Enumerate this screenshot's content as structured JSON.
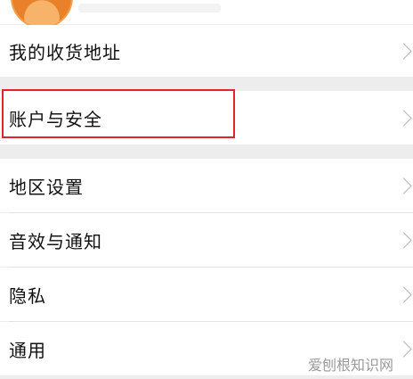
{
  "settings": {
    "items": [
      {
        "label": "我的收货地址"
      },
      {
        "label": "账户与安全"
      },
      {
        "label": "地区设置"
      },
      {
        "label": "音效与通知"
      },
      {
        "label": "隐私"
      },
      {
        "label": "通用"
      }
    ],
    "highlighted_item": "账户与安全",
    "highlight_color": "#e0242b"
  },
  "watermark": {
    "text": "爱刨根知识网"
  }
}
